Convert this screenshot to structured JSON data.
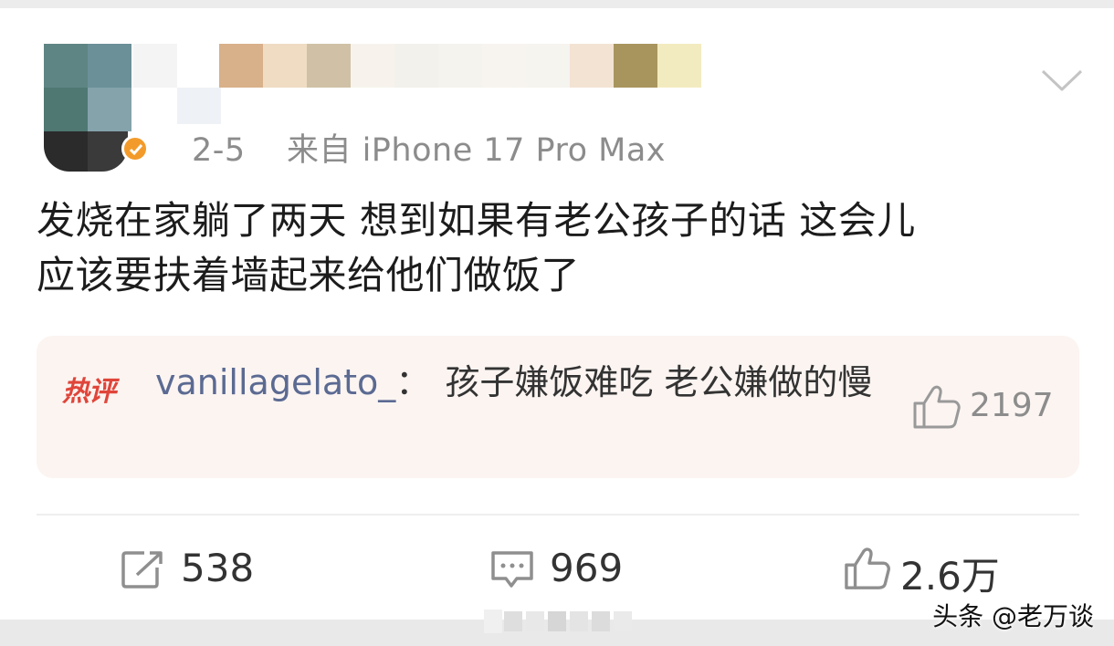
{
  "post": {
    "date": "2-5",
    "source": "来自 iPhone 17 Pro Max",
    "text_line1": "发烧在家躺了两天 想到如果有老公孩子的话 这会儿",
    "text_line2": "应该要扶着墙起来给他们做饭了"
  },
  "hot_comment": {
    "tag": "热评",
    "username": "vanillagelato_",
    "separator": "：",
    "content": "孩子嫌饭难吃 老公嫌做的慢",
    "likes": "2197"
  },
  "actions": {
    "repost_count": "538",
    "comment_count": "969",
    "like_count": "2.6万"
  },
  "watermark": "头条 @老万谈",
  "colors": {
    "accent_hot": "#e0453a",
    "username_link": "#5b6a92",
    "meta_gray": "#8c8c8c",
    "hot_bg": "#fbf4f1",
    "badge_orange": "#f39b2a"
  },
  "icons": {
    "more": "chevron-down-icon",
    "repost": "repost-icon",
    "comment": "comment-icon",
    "like": "thumbs-up-icon"
  }
}
